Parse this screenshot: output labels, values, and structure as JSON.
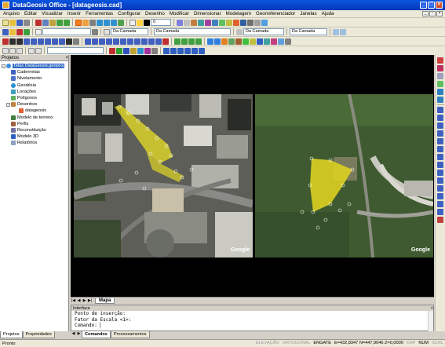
{
  "window": {
    "title": "DataGeosis Office - [datageosis.cad]"
  },
  "menu": [
    "Arquivo",
    "Editar",
    "Visualizar",
    "Inserir",
    "Ferramentas",
    "Configurar",
    "Desenho",
    "Modificar",
    "Dimensionar",
    "Modelagem",
    "Georreferenciador",
    "Janelas",
    "Ajuda"
  ],
  "toolbar": {
    "line_weight": "0",
    "layer_combo": "Da Camada",
    "layer_combo2": "Da Camada",
    "layer_combo3": "Da Camada",
    "layer_combo4": "Da Camada"
  },
  "projects_panel": {
    "title": "Projetos",
    "root": "Telas DataGeosis.geoproj",
    "items": [
      "Cadernetas",
      "Nivelamento",
      "Geodésia",
      "Locações",
      "Polígonos",
      "Desenhos",
      "datageosis",
      "Modelo de terreno",
      "Perfis",
      "Reconstituição",
      "Modelo 3D",
      "Relatórios"
    ]
  },
  "panel_tabs": [
    "Projetos",
    "Propriedades"
  ],
  "map": {
    "tab": "Mapa",
    "watermark_left": "Google",
    "watermark_right": "Google"
  },
  "interface": {
    "title": "Interface",
    "lines": [
      "Ponto de inserção:",
      "Fator da Escala <1>:",
      "Comando:"
    ]
  },
  "command_tabs": [
    "Comandos",
    "Processamentos"
  ],
  "status": {
    "left": "Pronto",
    "elevation": "ELEVAÇÃO",
    "orthogonal": "ORTOGONAL",
    "engate": "ENGATE",
    "coords": "E=432,8347 N=447,9046 Z=0,0000",
    "cap": "CAP",
    "num": "NUM",
    "scrl": "SCRL"
  }
}
